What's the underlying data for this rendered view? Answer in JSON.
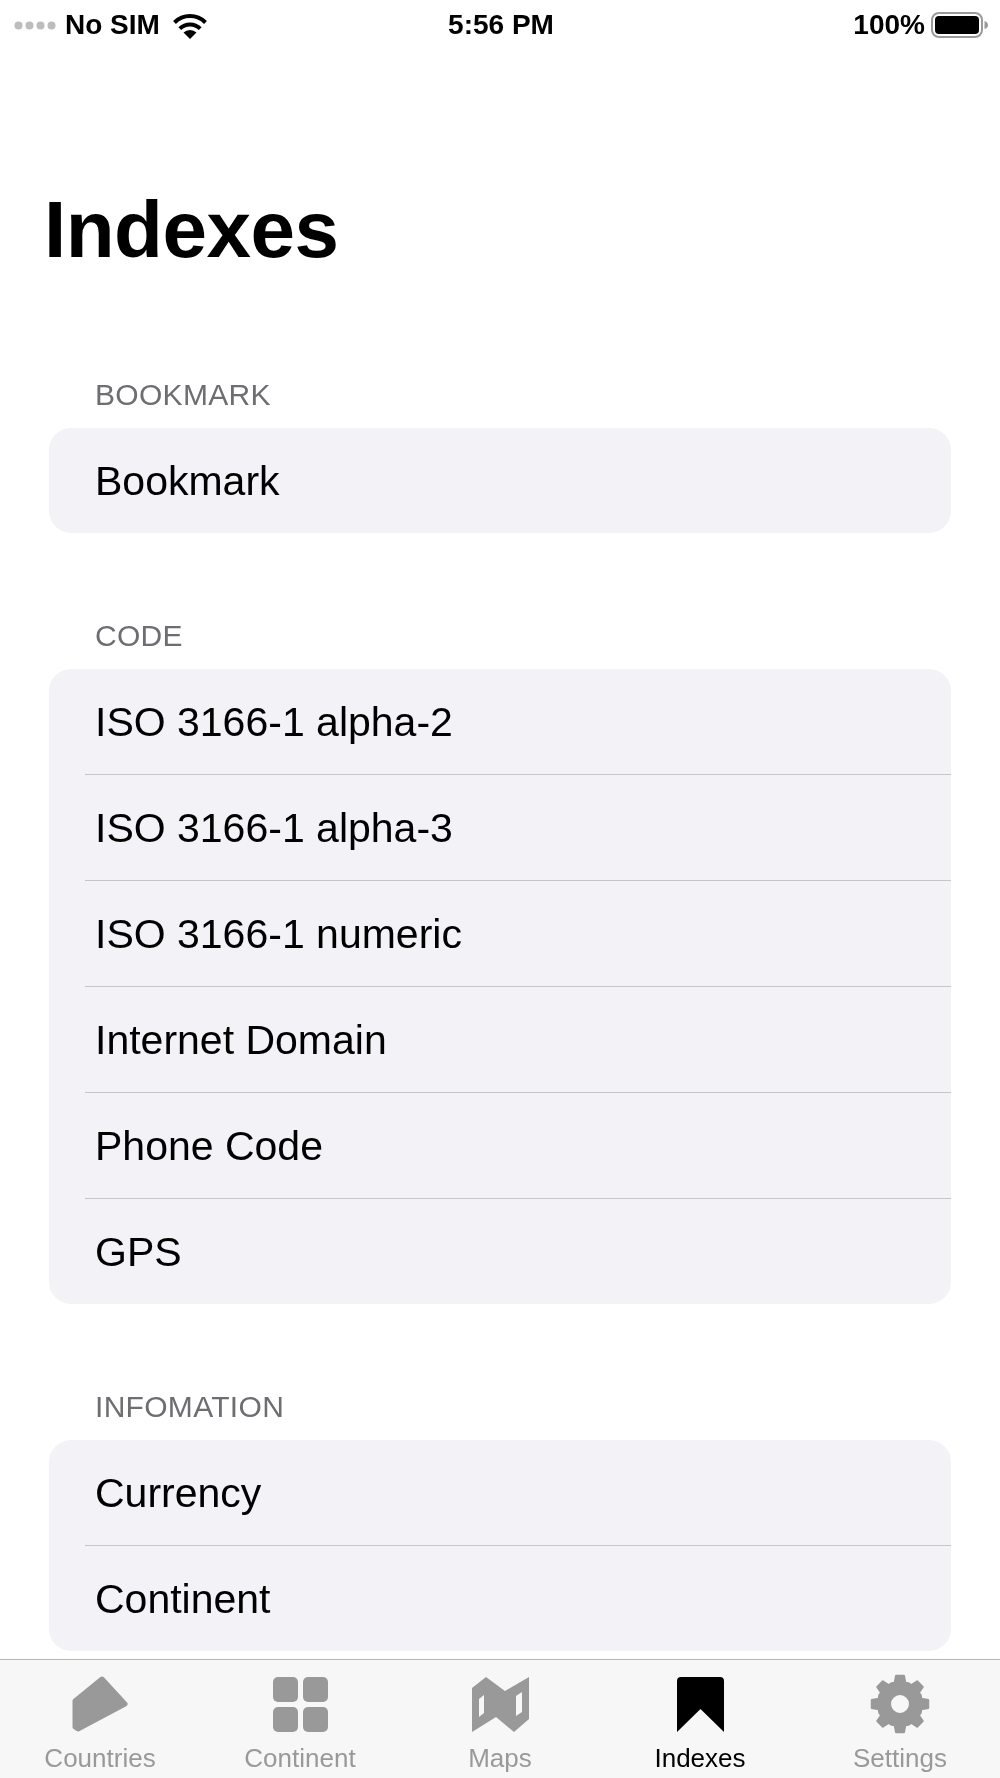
{
  "status_bar": {
    "carrier": "No SIM",
    "time": "5:56 PM",
    "battery": "100%"
  },
  "title": "Indexes",
  "sections": [
    {
      "header": "BOOKMARK",
      "rows": [
        "Bookmark"
      ]
    },
    {
      "header": "CODE",
      "rows": [
        "ISO 3166-1 alpha-2",
        "ISO 3166-1 alpha-3",
        "ISO 3166-1 numeric",
        "Internet Domain",
        "Phone Code",
        "GPS"
      ]
    },
    {
      "header": "INFOMATION",
      "rows": [
        "Currency",
        "Continent"
      ]
    }
  ],
  "tab_bar": [
    {
      "label": "Countries",
      "selected": false
    },
    {
      "label": "Continent",
      "selected": false
    },
    {
      "label": "Maps",
      "selected": false
    },
    {
      "label": "Indexes",
      "selected": true
    },
    {
      "label": "Settings",
      "selected": false
    }
  ]
}
